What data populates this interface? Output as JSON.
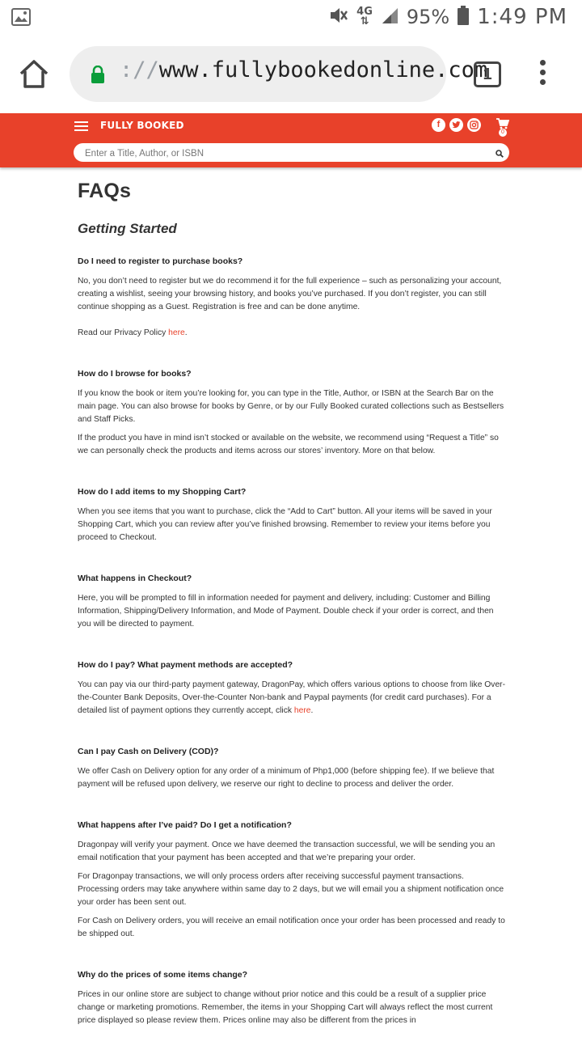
{
  "status_bar": {
    "network": "4G",
    "battery": "95%",
    "time": "1:49 PM"
  },
  "browser": {
    "url_scheme": "://",
    "url_host": "www.fullybookedonline.com",
    "tab_count": "1"
  },
  "site": {
    "logo": "FULLY BOOKED",
    "cart_count": "0",
    "search_placeholder": "Enter a Title, Author, or ISBN"
  },
  "page": {
    "title": "FAQs",
    "section": "Getting Started",
    "faqs": [
      {
        "q": "Do I need to register to purchase books?",
        "p1": "No, you don’t need to register but we do recommend it for the full experience – such as personalizing your account, creating a wishlist, seeing your browsing history, and books you’ve purchased. If you don’t register, you can still continue shopping as a Guest. Registration is free and can be done anytime.",
        "p2_pre": "Read our Privacy Policy ",
        "p2_link": "here",
        "p2_post": "."
      },
      {
        "q": "How do I browse for books?",
        "p1": "If you know the book or item you’re looking for, you can type in the Title, Author, or ISBN at the Search Bar on the main page. You can also browse for books by Genre, or by our Fully Booked curated collections such as Bestsellers and Staff Picks.",
        "p2": "If the product you have in mind isn’t stocked or available on the website, we recommend using “Request a Title” so we can personally check the products and items across our stores’ inventory. More on that below."
      },
      {
        "q": "How do I add items to my Shopping Cart?",
        "p1": "When you see items that you want to purchase, click the “Add to Cart” button. All your items will be saved in your Shopping Cart, which you can review after you’ve finished browsing. Remember to review your items before you proceed to Checkout."
      },
      {
        "q": "What happens in Checkout?",
        "p1": "Here, you will be prompted to fill in information needed for payment and delivery, including: Customer and Billing Information, Shipping/Delivery Information, and Mode of Payment. Double check if your order is correct, and then you will be directed to payment."
      },
      {
        "q": "How do I pay? What payment methods are accepted?",
        "p1_pre": "You can pay via our third-party payment gateway, DragonPay, which offers various options to choose from like Over-the-Counter Bank Deposits, Over-the-Counter Non-bank and Paypal payments (for credit card purchases). For a detailed list of payment options they currently accept, click ",
        "p1_link": "here",
        "p1_post": "."
      },
      {
        "q": "Can I pay Cash on Delivery (COD)?",
        "p1": "We offer Cash on Delivery option for any order of a minimum of Php1,000 (before shipping fee). If we believe that payment will be refused upon delivery, we reserve our right to decline to process and deliver the order."
      },
      {
        "q": "What happens after I’ve paid? Do I get a notification?",
        "p1": "Dragonpay will verify your payment. Once we have deemed the transaction successful, we will be sending you an email notification that your payment has been accepted and that we’re preparing your order.",
        "p2": "For Dragonpay transactions, we will only process orders after receiving successful payment transactions. Processing orders may take anywhere within same day to 2 days, but we will email you a shipment notification once your order has been sent out.",
        "p3": "For Cash on Delivery orders, you will receive an email notification once your order has been processed and ready to be shipped out."
      },
      {
        "q": "Why do the prices of some items change?",
        "p1": "Prices in our online store are subject to change without prior notice and this could be a result of a supplier price change or marketing promotions. Remember, the items in your Shopping Cart will always reflect the most current price displayed so please review them. Prices online may also be different from the prices in"
      }
    ]
  }
}
